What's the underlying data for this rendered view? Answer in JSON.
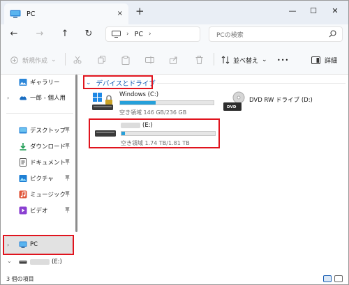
{
  "tab": {
    "title": "PC",
    "close": "×",
    "new": "+"
  },
  "window_controls": {
    "minimize": "—",
    "maximize": "☐",
    "close": "✕"
  },
  "nav": {
    "back": "←",
    "forward": "→",
    "up": "↑",
    "refresh": "↻",
    "address_chev": "›",
    "address_text": "PC",
    "address_chev2": "›",
    "search_placeholder": "PCの検索"
  },
  "toolbar": {
    "new_label": "新規作成",
    "new_chev": "⌄",
    "sort_label": "並べ替え",
    "sort_chev": "⌄",
    "more_label": "•••",
    "details_label": "詳細"
  },
  "sidebar": {
    "gallery": "ギャラリー",
    "onedrive": "一郎 - 個人用",
    "desktop": "デスクトップ",
    "downloads": "ダウンロード",
    "documents": "ドキュメント",
    "pictures": "ピクチャ",
    "music": "ミュージック",
    "videos": "ビデオ",
    "pc": "PC",
    "e_drive": "(E:)",
    "chev_right": "›",
    "chev_down": "⌄"
  },
  "content": {
    "section_title": "デバイスとドライブ",
    "section_chev": "⌄",
    "drives": [
      {
        "name": "Windows (C:)",
        "space": "空き領域 146 GB/236 GB",
        "used_fraction": 0.38
      },
      {
        "name": "(E:)",
        "space": "空き領域 1.74 TB/1.81 TB",
        "used_fraction": 0.04
      }
    ],
    "dvd": {
      "name": "DVD RW ドライブ (D:)",
      "badge": "DVD"
    }
  },
  "status": {
    "count": "3 個の項目"
  },
  "colors": {
    "accent": "#26a0da",
    "highlight": "#e0141e",
    "section_blue": "#1a5fb4"
  }
}
